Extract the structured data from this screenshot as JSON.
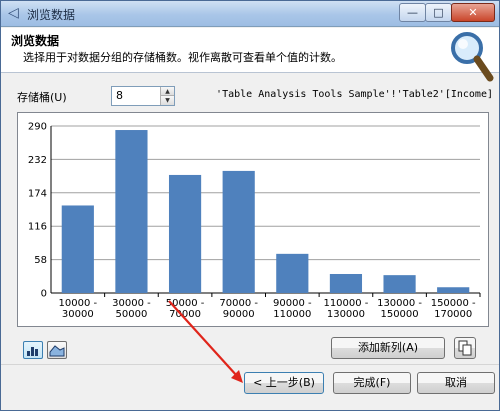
{
  "window": {
    "title": "浏览数据",
    "controls": {
      "minimize": "—",
      "maximize": "□",
      "close": "✕"
    }
  },
  "header": {
    "title": "浏览数据",
    "description": "选择用于对数据分组的存储桶数。视作离散可查看单个值的计数。"
  },
  "bins": {
    "label": "存储桶(U)",
    "value": "8"
  },
  "source": "'Table Analysis Tools Sample'!'Table2'[Income]",
  "chart_data": {
    "type": "bar",
    "categories": [
      [
        "10000 -",
        "30000"
      ],
      [
        "30000 -",
        "50000"
      ],
      [
        "50000 -",
        "70000"
      ],
      [
        "70000 -",
        "90000"
      ],
      [
        "90000 -",
        "110000"
      ],
      [
        "110000 -",
        "130000"
      ],
      [
        "130000 -",
        "150000"
      ],
      [
        "150000 -",
        "170000"
      ]
    ],
    "values": [
      152,
      283,
      205,
      212,
      68,
      33,
      31,
      10
    ],
    "yticks": [
      "290",
      "232",
      "174",
      "116",
      "58",
      "0"
    ],
    "ylim": [
      0,
      290
    ],
    "bar_color": "#4f81bd",
    "grid": true
  },
  "buttons": {
    "add_column": "添加新列(A)",
    "prev": "< 上一步(B)",
    "finish": "完成(F)",
    "cancel": "取消"
  },
  "icons": {
    "back": "back-arrow-icon",
    "magnifier": "magnifier-icon",
    "bar_view": "bar-chart-icon",
    "area_view": "area-chart-icon",
    "copy": "copy-icon"
  }
}
